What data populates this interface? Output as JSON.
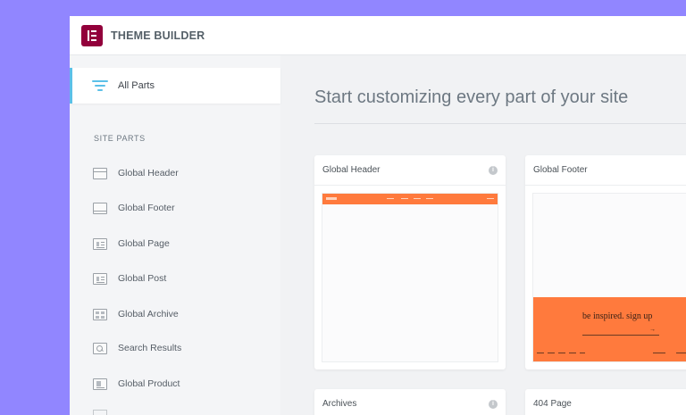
{
  "app": {
    "title": "THEME BUILDER"
  },
  "sidebar": {
    "all_parts": "All Parts",
    "section_title": "SITE PARTS",
    "items": [
      {
        "label": "Global Header",
        "icon": "header-layout-icon"
      },
      {
        "label": "Global Footer",
        "icon": "footer-layout-icon"
      },
      {
        "label": "Global Page",
        "icon": "page-layout-icon"
      },
      {
        "label": "Global Post",
        "icon": "post-layout-icon"
      },
      {
        "label": "Global Archive",
        "icon": "archive-layout-icon"
      },
      {
        "label": "Search Results",
        "icon": "search-results-icon"
      },
      {
        "label": "Global Product",
        "icon": "product-layout-icon"
      }
    ]
  },
  "main": {
    "title": "Start customizing every part of your site",
    "cards": [
      {
        "title": "Global Header"
      },
      {
        "title": "Global Footer",
        "preview_text": "be inspired. sign up"
      },
      {
        "title": "Archives"
      },
      {
        "title": "404 Page"
      }
    ]
  },
  "colors": {
    "accent": "#5bc0e8",
    "brand": "#92003b",
    "preview_orange": "#ff7a3d",
    "background": "#9186ff"
  }
}
